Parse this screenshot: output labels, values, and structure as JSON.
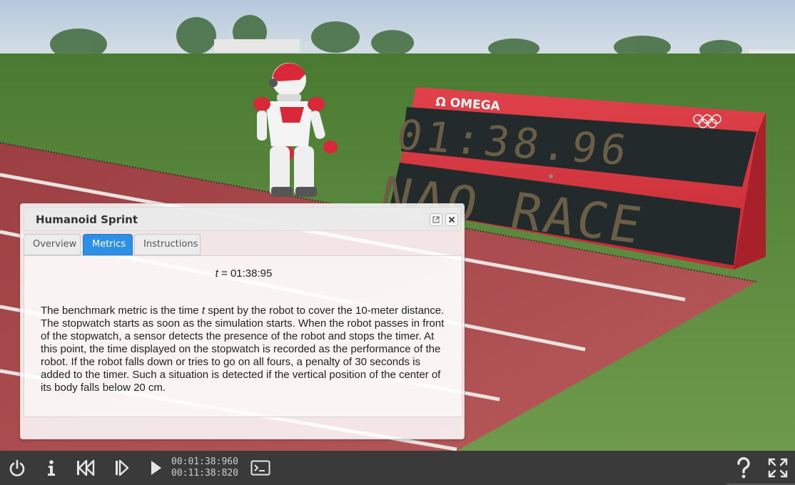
{
  "scoreboard": {
    "brand": "Ω OMEGA",
    "time_display": "01:38.96",
    "text_display": "NAO RACE"
  },
  "panel": {
    "title": "Humanoid Sprint",
    "tabs": [
      {
        "label": "Overview",
        "active": false
      },
      {
        "label": "Metrics",
        "active": true
      },
      {
        "label": "Instructions",
        "active": false
      }
    ],
    "metric": {
      "variable": "t",
      "equals": " = 01:38:95"
    },
    "description": {
      "part1": "The benchmark metric is the time ",
      "variable": "t",
      "part2": " spent by the robot to cover the 10-meter distance. The stopwatch starts as soon as the simulation starts. When the robot passes in front of the stopwatch, a sensor detects the presence of the robot and stops the timer. At this point, the time displayed on the stopwatch is recorded as the performance of the robot. If the robot falls down or tries to go on all fours, a penalty of 30 seconds is added to the timer. Such a situation is detected if the vertical position of the center of its body falls below 20 cm."
    }
  },
  "toolbar": {
    "simulation_time": "00:01:38:960",
    "real_time": "00:11:38:820",
    "icons": [
      "power-icon",
      "info-icon",
      "reset-icon",
      "step-icon",
      "play-icon",
      "console-icon",
      "help-icon",
      "fullscreen-icon"
    ]
  },
  "colors": {
    "accent_tab": "#2d8fe6",
    "toolbar_bg": "#3a3a3a",
    "track_red": "#a8474a",
    "scoreboard_red": "#d8353f"
  }
}
